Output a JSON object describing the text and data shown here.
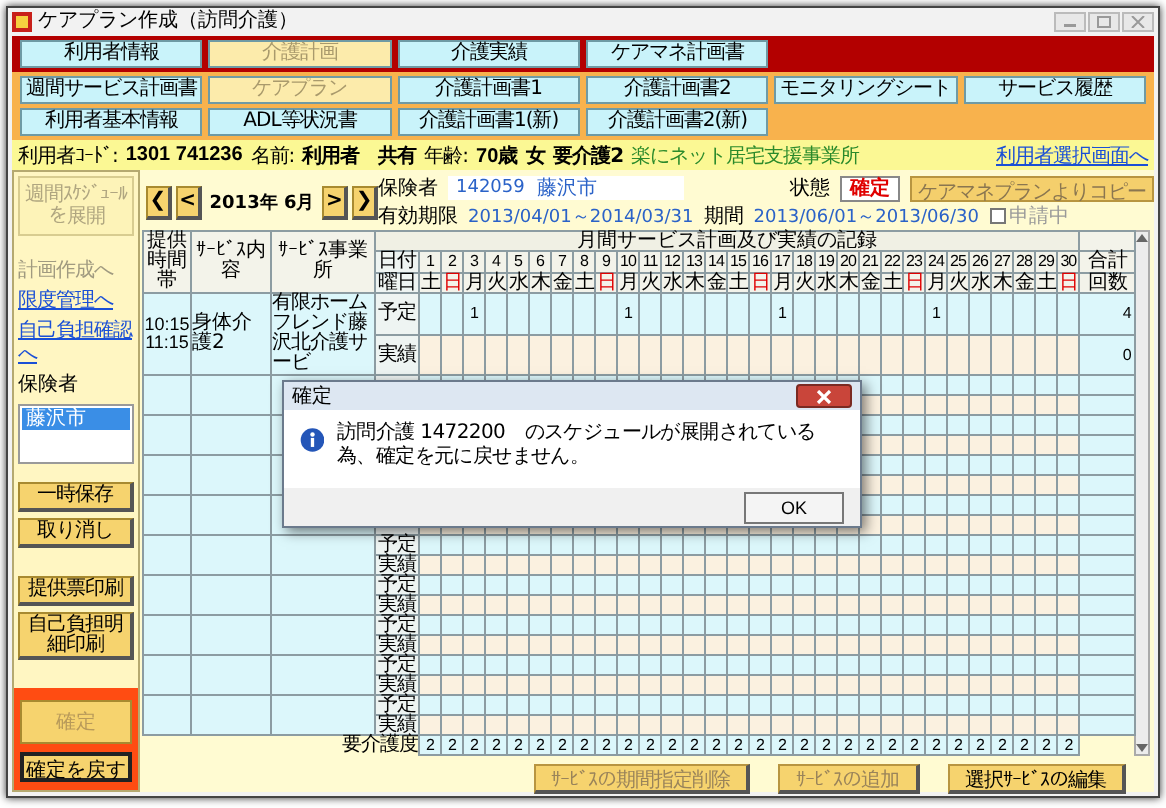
{
  "window": {
    "title": "ケアプラン作成（訪問介護）"
  },
  "main_tabs": [
    {
      "label": "利用者情報",
      "selected": false
    },
    {
      "label": "介護計画",
      "selected": true
    },
    {
      "label": "介護実績",
      "selected": false
    },
    {
      "label": "ケアマネ計画書",
      "selected": false
    }
  ],
  "sub_tab_rows": [
    {
      "tabs": [
        {
          "label": "週間サービス計画書",
          "selected": false
        },
        {
          "label": "ケアプラン",
          "selected": true
        },
        {
          "label": "介護計画書1",
          "selected": false
        },
        {
          "label": "介護計画書2",
          "selected": false
        },
        {
          "label": "モニタリングシート",
          "selected": false
        },
        {
          "label": "サービス履歴",
          "selected": false
        }
      ]
    },
    {
      "tabs": [
        {
          "label": "利用者基本情報",
          "selected": false
        },
        {
          "label": "ADL等状況書",
          "selected": false
        },
        {
          "label": "介護計画書1(新)",
          "selected": false
        },
        {
          "label": "介護計画書2(新)",
          "selected": false
        }
      ]
    }
  ],
  "patient": {
    "code_label": "利用者ｺｰﾄﾞ:",
    "code": "1301 741236",
    "name_label": "名前:",
    "name": "利用者　共有",
    "age_label": "年齢:",
    "age": "70歳",
    "sex": "女",
    "care_level": "要介護2",
    "office": "楽にネット居宅支援事業所",
    "select_link": "利用者選択画面へ"
  },
  "sidebar": {
    "expand_button": {
      "label": "週間ｽｹｼﾞｭｰﾙを展開",
      "disabled": true
    },
    "links": [
      {
        "label": "計画作成へ",
        "disabled": true
      },
      {
        "label": "限度管理へ",
        "disabled": false
      },
      {
        "label": "自己負担確認へ",
        "disabled": false
      }
    ],
    "insurer_label": "保険者",
    "insurers": [
      {
        "label": "藤沢市",
        "selected": true
      }
    ],
    "buttons": [
      {
        "label": "一時保存"
      },
      {
        "label": "取り消し"
      },
      {
        "label": "提供票印刷"
      },
      {
        "label": "自己負担明細印刷"
      }
    ],
    "confirm_buttons": [
      {
        "label": "確定",
        "disabled": true
      },
      {
        "label": "確定を戻す",
        "disabled": false
      }
    ]
  },
  "month_nav": {
    "first": "❮",
    "prev": "<",
    "month": "2013年 6月",
    "next": ">",
    "last": "❯"
  },
  "header": {
    "insurer_label": "保険者",
    "insurer_no": "142059",
    "insurer_name": "藤沢市",
    "status_label": "状態",
    "status": "確定",
    "copy_button": "ケアマネプランよりコピー",
    "valid_label": "有効期限",
    "valid_period": "2013/04/01～2014/03/31",
    "period_label": "期間",
    "period": "2013/06/01～2013/06/30",
    "applying": {
      "label": "申請中",
      "checked": false,
      "disabled": true
    }
  },
  "schedule": {
    "title": "月間サービス計画及び実績の記録",
    "columns": [
      "提供時間帯",
      "ｻｰﾋﾞｽ内容",
      "ｻｰﾋﾞｽ事業所"
    ],
    "date_label": "日付",
    "weekday_label": "曜日",
    "total_labels": [
      "合計",
      "回数"
    ],
    "days": [
      {
        "date": "1",
        "weekday": "土",
        "holiday": false
      },
      {
        "date": "2",
        "weekday": "日",
        "holiday": true
      },
      {
        "date": "3",
        "weekday": "月",
        "holiday": false
      },
      {
        "date": "4",
        "weekday": "火",
        "holiday": false
      },
      {
        "date": "5",
        "weekday": "水",
        "holiday": false
      },
      {
        "date": "6",
        "weekday": "木",
        "holiday": false
      },
      {
        "date": "7",
        "weekday": "金",
        "holiday": false
      },
      {
        "date": "8",
        "weekday": "土",
        "holiday": false
      },
      {
        "date": "9",
        "weekday": "日",
        "holiday": true
      },
      {
        "date": "10",
        "weekday": "月",
        "holiday": false
      },
      {
        "date": "11",
        "weekday": "火",
        "holiday": false
      },
      {
        "date": "12",
        "weekday": "水",
        "holiday": false
      },
      {
        "date": "13",
        "weekday": "木",
        "holiday": false
      },
      {
        "date": "14",
        "weekday": "金",
        "holiday": false
      },
      {
        "date": "15",
        "weekday": "土",
        "holiday": false
      },
      {
        "date": "16",
        "weekday": "日",
        "holiday": true
      },
      {
        "date": "17",
        "weekday": "月",
        "holiday": false
      },
      {
        "date": "18",
        "weekday": "火",
        "holiday": false
      },
      {
        "date": "19",
        "weekday": "水",
        "holiday": false
      },
      {
        "date": "20",
        "weekday": "木",
        "holiday": false
      },
      {
        "date": "21",
        "weekday": "金",
        "holiday": false
      },
      {
        "date": "22",
        "weekday": "土",
        "holiday": false
      },
      {
        "date": "23",
        "weekday": "日",
        "holiday": true
      },
      {
        "date": "24",
        "weekday": "月",
        "holiday": false
      },
      {
        "date": "25",
        "weekday": "火",
        "holiday": false
      },
      {
        "date": "26",
        "weekday": "水",
        "holiday": false
      },
      {
        "date": "27",
        "weekday": "木",
        "holiday": false
      },
      {
        "date": "28",
        "weekday": "金",
        "holiday": false
      },
      {
        "date": "29",
        "weekday": "土",
        "holiday": false
      },
      {
        "date": "30",
        "weekday": "日",
        "holiday": true
      }
    ],
    "rows": [
      {
        "kind": "service",
        "time": [
          "10:15",
          "11:15"
        ],
        "service": "身体介護2",
        "provider": "有限ホームフレンド藤沢北介護サービ",
        "plan_label": "予定",
        "actual_label": "実績",
        "plan": [
          {
            "kind": "blank"
          },
          {
            "kind": "blank"
          },
          {
            "kind": "count",
            "text": "1"
          },
          {
            "kind": "blank"
          },
          {
            "kind": "blank"
          },
          {
            "kind": "blank"
          },
          {
            "kind": "blank"
          },
          {
            "kind": "blank"
          },
          {
            "kind": "blank"
          },
          {
            "kind": "count",
            "text": "1"
          },
          {
            "kind": "blank"
          },
          {
            "kind": "blank"
          },
          {
            "kind": "blank"
          },
          {
            "kind": "blank"
          },
          {
            "kind": "blank"
          },
          {
            "kind": "blank"
          },
          {
            "kind": "count",
            "text": "1"
          },
          {
            "kind": "blank"
          },
          {
            "kind": "blank"
          },
          {
            "kind": "blank"
          },
          {
            "kind": "blank"
          },
          {
            "kind": "blank"
          },
          {
            "kind": "blank"
          },
          {
            "kind": "count",
            "text": "1"
          },
          {
            "kind": "blank"
          },
          {
            "kind": "blank"
          },
          {
            "kind": "blank"
          },
          {
            "kind": "blank"
          },
          {
            "kind": "blank"
          },
          {
            "kind": "blank"
          }
        ],
        "plan_total": "4",
        "actual_total": "0"
      },
      {
        "kind": "covered"
      },
      {
        "kind": "covered"
      },
      {
        "kind": "covered"
      },
      {
        "kind": "covered"
      },
      {
        "kind": "empty",
        "plan_label": "予定",
        "actual_label": "実績"
      },
      {
        "kind": "empty",
        "plan_label": "予定",
        "actual_label": "実績"
      },
      {
        "kind": "empty",
        "plan_label": "予定",
        "actual_label": "実績"
      },
      {
        "kind": "empty",
        "plan_label": "予定",
        "actual_label": "実績"
      },
      {
        "kind": "empty",
        "plan_label": "予定",
        "actual_label": "実績"
      }
    ],
    "care_level_label": "要介護度",
    "care_levels": [
      "2",
      "2",
      "2",
      "2",
      "2",
      "2",
      "2",
      "2",
      "2",
      "2",
      "2",
      "2",
      "2",
      "2",
      "2",
      "2",
      "2",
      "2",
      "2",
      "2",
      "2",
      "2",
      "2",
      "2",
      "2",
      "2",
      "2",
      "2",
      "2",
      "2"
    ]
  },
  "dialog": {
    "title": "確定",
    "message": "訪問介護 1472200　のスケジュールが展開されている為、確定を元に戻せません。",
    "button": "OK"
  },
  "bottom_buttons": [
    {
      "label": "ｻｰﾋﾞｽの期間指定削除",
      "disabled": true
    },
    {
      "label": "ｻｰﾋﾞｽの追加",
      "disabled": true
    },
    {
      "label": "選択ｻｰﾋﾞｽの編集",
      "disabled": false
    }
  ]
}
